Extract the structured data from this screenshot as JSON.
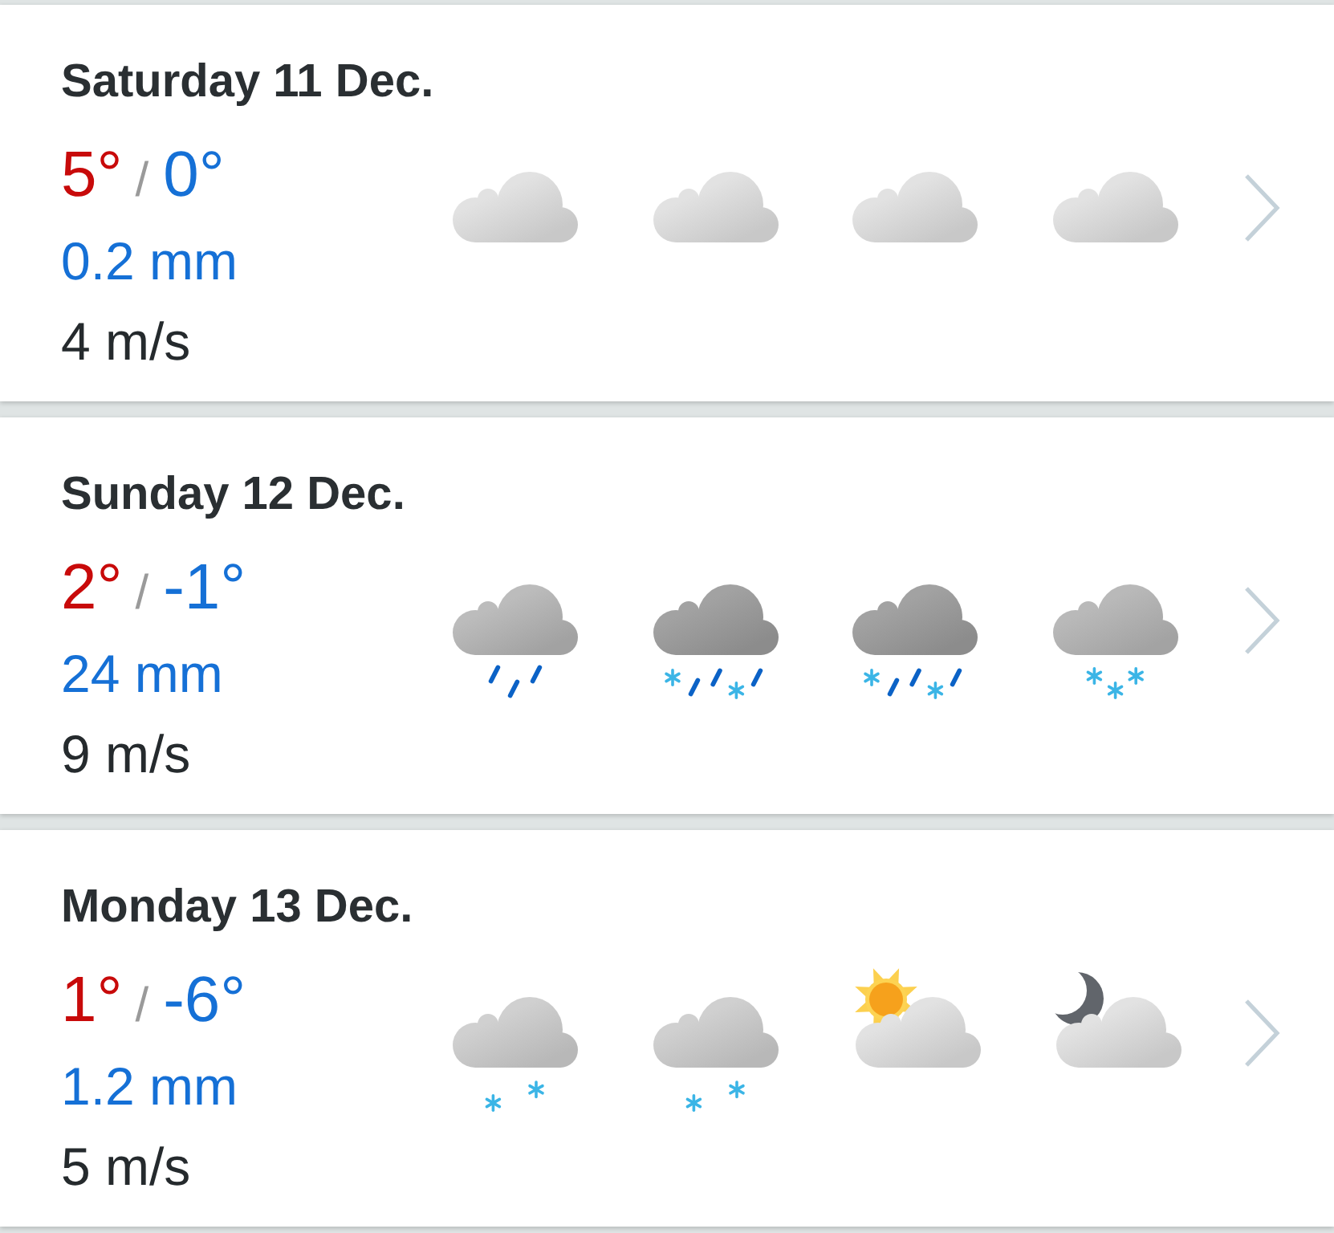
{
  "days": [
    {
      "date": "Saturday 11 Dec.",
      "high": "5°",
      "separator": "/",
      "low": "0°",
      "precipitation": "0.2 mm",
      "wind": "4 m/s",
      "forecast": [
        {
          "kind": "cloudy"
        },
        {
          "kind": "cloudy"
        },
        {
          "kind": "cloudy"
        },
        {
          "kind": "cloudy"
        }
      ]
    },
    {
      "date": "Sunday 12 Dec.",
      "high": "2°",
      "separator": "/",
      "low": "-1°",
      "precipitation": "24 mm",
      "wind": "9 m/s",
      "forecast": [
        {
          "kind": "rain"
        },
        {
          "kind": "sleet"
        },
        {
          "kind": "sleet"
        },
        {
          "kind": "snow"
        }
      ]
    },
    {
      "date": "Monday 13 Dec.",
      "high": "1°",
      "separator": "/",
      "low": "-6°",
      "precipitation": "1.2 mm",
      "wind": "5 m/s",
      "forecast": [
        {
          "kind": "light-snow"
        },
        {
          "kind": "light-snow"
        },
        {
          "kind": "partly-cloudy-day"
        },
        {
          "kind": "partly-cloudy-night"
        }
      ]
    }
  ]
}
